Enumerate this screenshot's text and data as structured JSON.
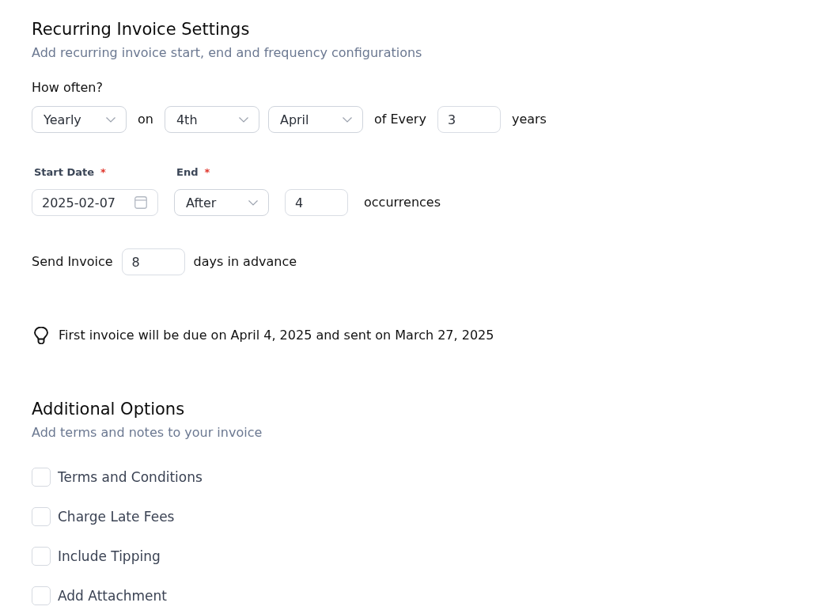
{
  "recurring_settings": {
    "title": "Recurring Invoice Settings",
    "subtitle": "Add recurring invoice start, end and frequency configurations",
    "frequency": {
      "label": "How often?",
      "items": [
        {
          "kind": "select",
          "value": "Yearly"
        },
        {
          "kind": "text",
          "text": "on"
        },
        {
          "kind": "select",
          "value": "4th"
        },
        {
          "kind": "select",
          "value": "April"
        },
        {
          "kind": "text",
          "text": "of Every"
        },
        {
          "kind": "input",
          "value": "3"
        },
        {
          "kind": "text",
          "text": "years"
        }
      ]
    },
    "schedule": {
      "items": [
        {
          "kind": "date",
          "label": "Start Date",
          "required_mark": "*",
          "value": "2025-02-07"
        },
        {
          "kind": "select",
          "label": "End",
          "required_mark": "*",
          "value": "After"
        },
        {
          "kind": "input",
          "value": "4"
        },
        {
          "kind": "text",
          "text": "occurrences"
        }
      ]
    },
    "advance": {
      "items": [
        {
          "kind": "text",
          "text": "Send Invoice"
        },
        {
          "kind": "input",
          "value": "8"
        },
        {
          "kind": "text",
          "text": "days in advance"
        }
      ]
    },
    "hint": {
      "text": "First invoice will be due on April 4, 2025 and sent on March 27, 2025"
    }
  },
  "additional_options": {
    "title": "Additional Options",
    "subtitle": "Add terms and notes to your invoice",
    "options": [
      {
        "label": "Terms and Conditions",
        "checked": false
      },
      {
        "label": "Charge Late Fees",
        "checked": false
      },
      {
        "label": "Include Tipping",
        "checked": false
      },
      {
        "label": "Add Attachment",
        "checked": false
      }
    ]
  }
}
